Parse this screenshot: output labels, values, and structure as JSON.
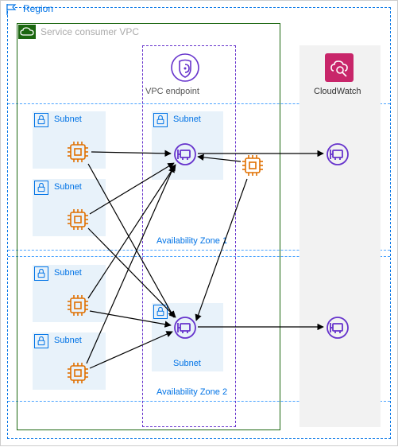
{
  "region": {
    "label": "Region"
  },
  "vpc": {
    "label": "Service consumer VPC"
  },
  "endpoint": {
    "label": "VPC endpoint"
  },
  "cloudwatch": {
    "label": "CloudWatch"
  },
  "az1": {
    "label": "Availability Zone 1"
  },
  "az2": {
    "label": "Availability Zone 2"
  },
  "subnets": {
    "s1": "Subnet",
    "s2": "Subnet",
    "s3": "Subnet",
    "s4": "Subnet",
    "s5": "Subnet",
    "s6": "Subnet"
  },
  "icons": {
    "flag": "flag-icon",
    "cloud": "cloud-icon",
    "shield": "shield-in-circle",
    "magnifier": "cloud-magnifier",
    "lock": "lock-icon",
    "chip": "compute-chip",
    "eni": "network-interface"
  },
  "colors": {
    "region_border": "#0073e6",
    "vpc_border": "#1b660f",
    "endpoint_border": "#6633cc",
    "az_blue": "#4aa3ff",
    "chip_orange": "#e07000",
    "eni_purple": "#6633cc",
    "cw_bg": "#f2f2f2",
    "cw_icon": "#c8266a"
  }
}
